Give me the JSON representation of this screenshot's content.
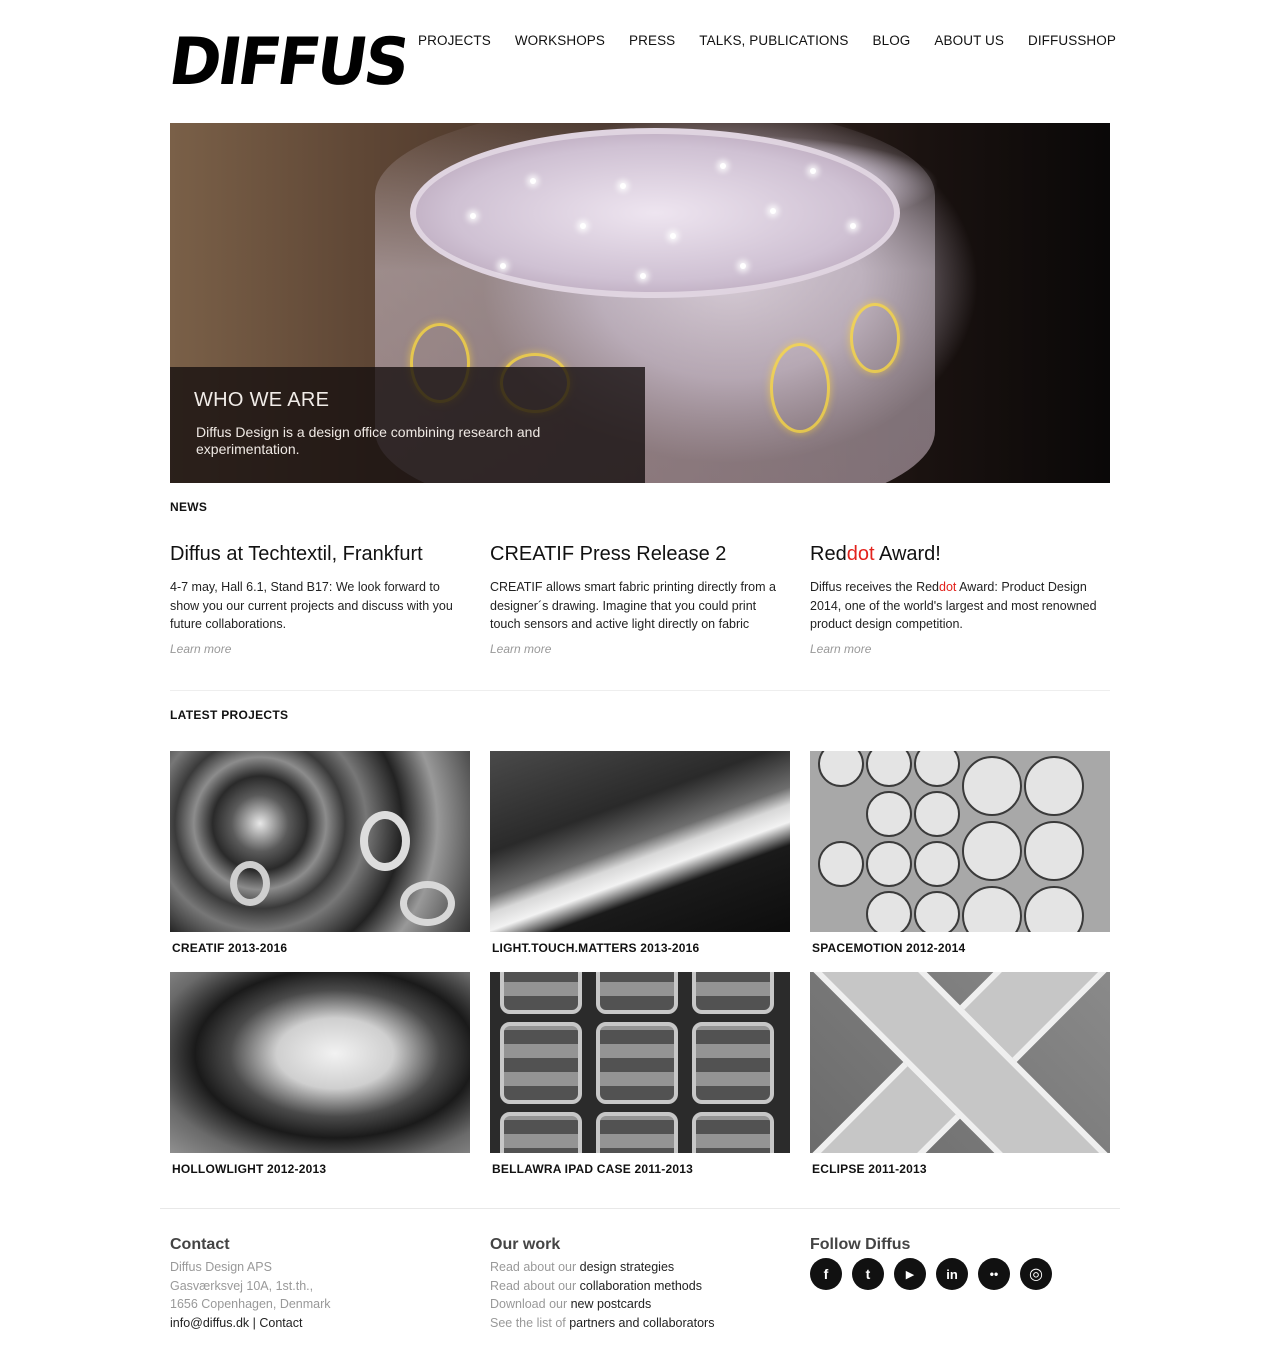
{
  "logo": {
    "text": "DIFFUS"
  },
  "nav": [
    "PROJECTS",
    "WORKSHOPS",
    "PRESS",
    "TALKS, PUBLICATIONS",
    "BLOG",
    "ABOUT US",
    "DIFFUSSHOP"
  ],
  "hero": {
    "title": "WHO WE ARE",
    "text": "Diffus Design is a design office combining research and experimentation."
  },
  "news": {
    "heading": "NEWS",
    "items": [
      {
        "title": "Diffus at Techtextil, Frankfurt",
        "text": "4-7 may, Hall 6.1, Stand B17: We look forward to show you our current projects and discuss with you future collaborations.",
        "more": "Learn more"
      },
      {
        "title": "CREATIF Press Release 2",
        "text": "CREATIF allows smart fabric printing directly from a designer´s drawing. Imagine that you could print touch sensors and active light directly on fabric",
        "more": "Learn more"
      },
      {
        "title_a": "Red",
        "title_b": "dot",
        "title_c": " Award!",
        "text_a": "Diffus receives the Red",
        "text_b": "dot",
        "text_c": " Award: Product Design 2014, one of the world's largest and most renowned product design competition.",
        "more": "Learn more"
      }
    ]
  },
  "projects": {
    "heading": "LATEST PROJECTS",
    "items": [
      "CREATIF 2013-2016",
      "LIGHT.TOUCH.MATTERS 2013-2016",
      "SPACEMOTION 2012-2014",
      "HOLLOWLIGHT 2012-2013",
      "BELLAWRA IPAD CASE 2011-2013",
      "ECLIPSE 2011-2013"
    ]
  },
  "footer": {
    "contact": {
      "heading": "Contact",
      "lines": [
        "Diffus Design APS",
        "Gasværksvej 10A, 1st.th.,",
        "1656 Copenhagen, Denmark"
      ],
      "email": "info@diffus.dk",
      "sep": " | ",
      "contact_link": "Contact"
    },
    "work": {
      "heading": "Our work",
      "lines": [
        {
          "pre": "Read about our ",
          "link": "design strategies"
        },
        {
          "pre": "Read about our ",
          "link": "collaboration methods"
        },
        {
          "pre": "Download our ",
          "link": "new postcards"
        },
        {
          "pre": "See the list of ",
          "link": "partners and collaborators"
        }
      ]
    },
    "follow": {
      "heading": "Follow Diffus",
      "icons": [
        {
          "name": "facebook-icon",
          "glyph": "f"
        },
        {
          "name": "twitter-icon",
          "glyph": "t"
        },
        {
          "name": "youtube-icon",
          "glyph": "▶"
        },
        {
          "name": "linkedin-icon",
          "glyph": "in"
        },
        {
          "name": "flickr-icon",
          "glyph": "••"
        },
        {
          "name": "instagram-icon",
          "glyph": "◎"
        }
      ]
    }
  }
}
